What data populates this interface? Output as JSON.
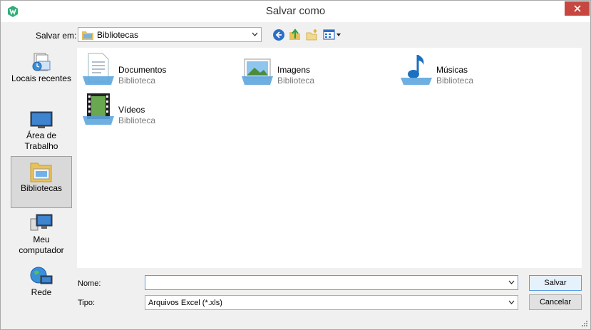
{
  "window": {
    "title": "Salvar como",
    "close_label": "✕"
  },
  "toolbar": {
    "lookin_label": "Salvar em:",
    "lookin_value": "Bibliotecas",
    "buttons": [
      "back-icon",
      "up-folder-icon",
      "new-folder-icon",
      "view-menu-icon"
    ]
  },
  "places": [
    {
      "id": "recent",
      "label": "Locais recentes",
      "icon": "recent-places-icon"
    },
    {
      "id": "desktop",
      "label": "Área de Trabalho",
      "icon": "desktop-icon"
    },
    {
      "id": "libraries",
      "label": "Bibliotecas",
      "icon": "libraries-icon",
      "selected": true
    },
    {
      "id": "computer",
      "label": "Meu computador",
      "icon": "computer-icon"
    },
    {
      "id": "network",
      "label": "Rede",
      "icon": "network-icon"
    }
  ],
  "items": [
    {
      "name": "Documentos",
      "type": "Biblioteca",
      "icon": "documents-library-icon"
    },
    {
      "name": "Imagens",
      "type": "Biblioteca",
      "icon": "pictures-library-icon"
    },
    {
      "name": "Músicas",
      "type": "Biblioteca",
      "icon": "music-library-icon"
    },
    {
      "name": "Vídeos",
      "type": "Biblioteca",
      "icon": "videos-library-icon"
    }
  ],
  "form": {
    "name_label": "Nome:",
    "name_value": "",
    "type_label": "Tipo:",
    "type_value": "Arquivos Excel (*.xls)",
    "save_label": "Salvar",
    "cancel_label": "Cancelar"
  }
}
